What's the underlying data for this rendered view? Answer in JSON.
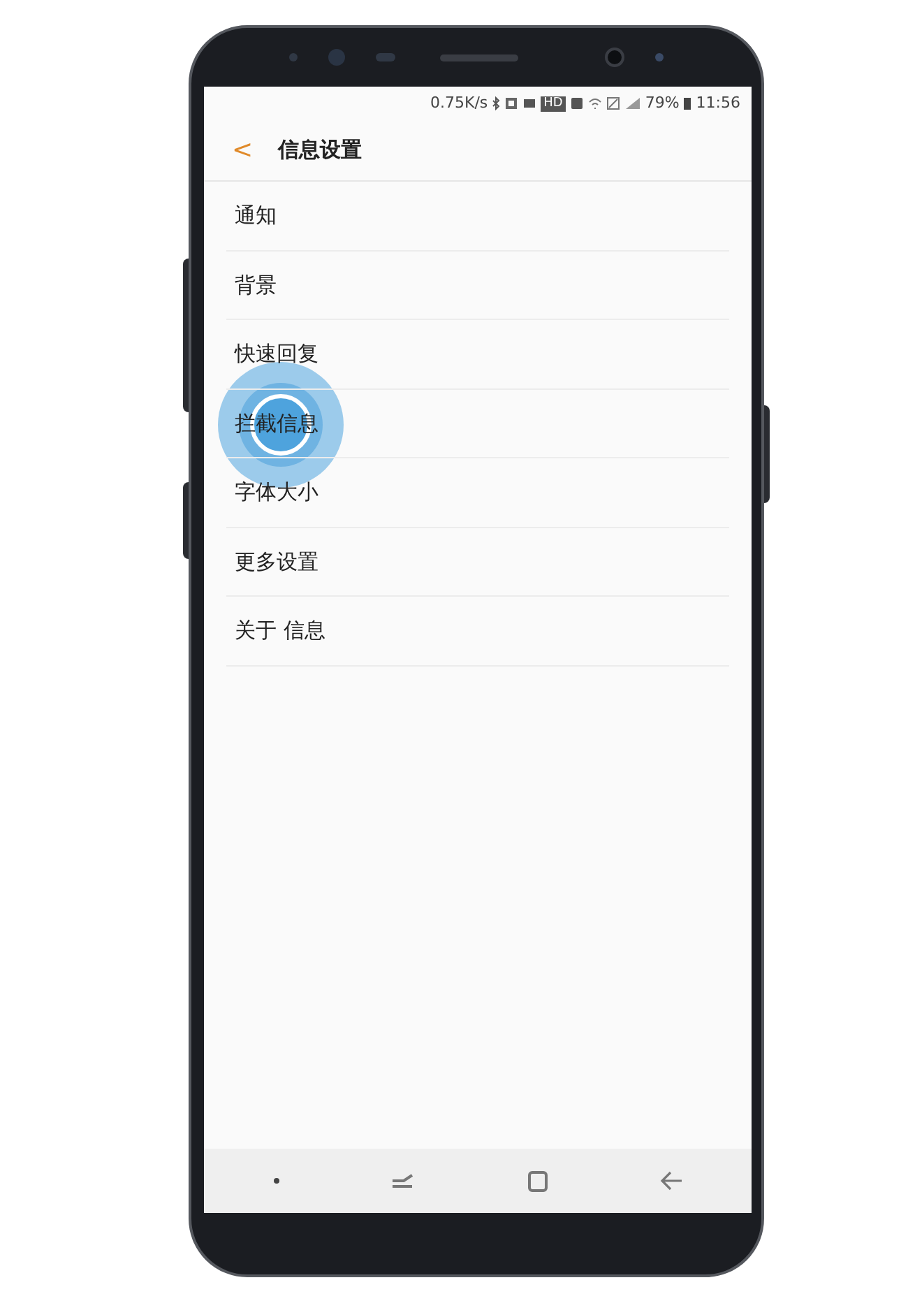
{
  "status_bar": {
    "speed": "0.75K/s",
    "hd_badge": "HD",
    "battery": "79%",
    "time": "11:56"
  },
  "header": {
    "back": "<",
    "title": "信息设置"
  },
  "items": [
    {
      "label": "通知",
      "touched": false
    },
    {
      "label": "背景",
      "touched": false
    },
    {
      "label": "快速回复",
      "touched": false
    },
    {
      "label": "拦截信息",
      "touched": true
    },
    {
      "label": "字体大小",
      "touched": false
    },
    {
      "label": "更多设置",
      "touched": false
    },
    {
      "label": "关于 信息",
      "touched": false
    }
  ]
}
